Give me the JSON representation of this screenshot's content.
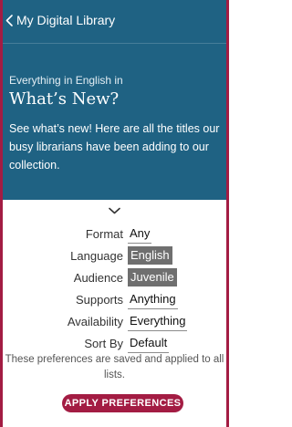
{
  "header": {
    "back_label": "My Digital Library",
    "eyebrow": "Everything in English in",
    "title": "What’s New?",
    "description": "See what’s new! Here are all the titles our busy librarians have been adding to our collection."
  },
  "preferences": [
    {
      "label": "Format",
      "value": "Any",
      "selected": false
    },
    {
      "label": "Language",
      "value": "English",
      "selected": true
    },
    {
      "label": "Audience",
      "value": "Juvenile",
      "selected": true
    },
    {
      "label": "Supports",
      "value": "Anything",
      "selected": false
    },
    {
      "label": "Availability",
      "value": "Everything",
      "selected": false
    },
    {
      "label": "Sort By",
      "value": "Default",
      "selected": false
    }
  ],
  "note": "These preferences are saved and applied to all lists.",
  "apply_button": "APPLY PREFERENCES",
  "icons": {
    "back": "chevron-left-icon",
    "collapse": "chevron-down-icon"
  },
  "colors": {
    "header_bg": "#1f6283",
    "accent": "#a31c43",
    "selected_bg": "#6f6f6f"
  }
}
